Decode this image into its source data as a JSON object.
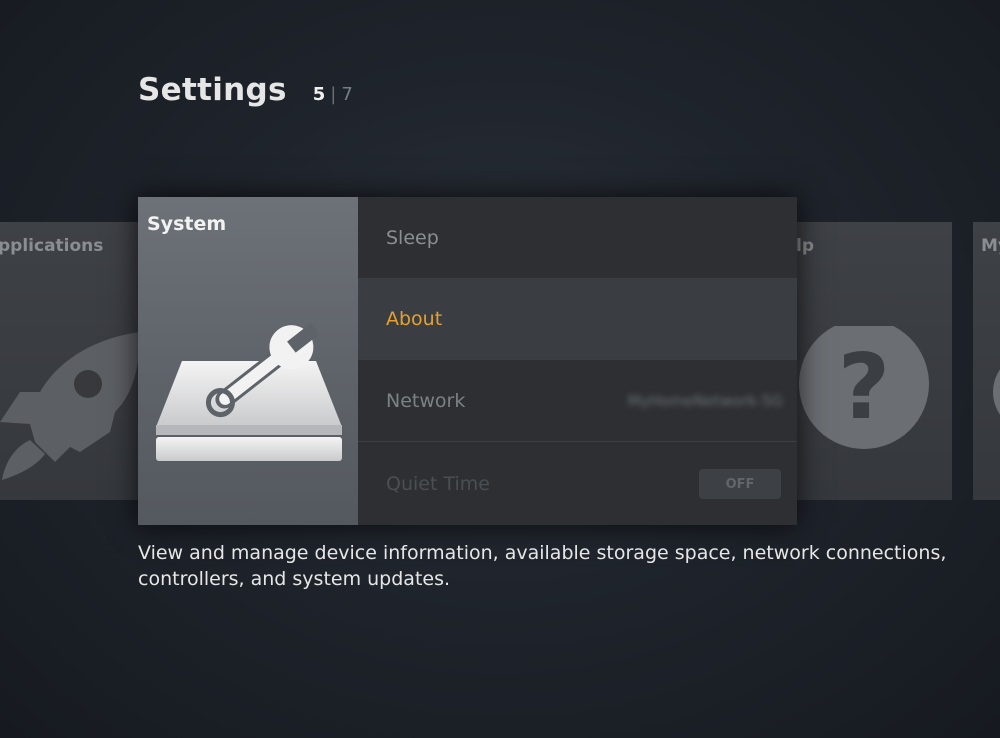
{
  "header": {
    "title": "Settings",
    "pager_current": "5",
    "pager_separator": "|",
    "pager_total": "7"
  },
  "cards": {
    "left_label": "Applications",
    "right_label": "Help",
    "far_right_label": "My"
  },
  "focused": {
    "tile_label": "System",
    "tile_icon": "system-wrench-icon"
  },
  "menu": {
    "items": [
      {
        "label": "Sleep"
      },
      {
        "label": "About"
      },
      {
        "label": "Network",
        "value": "MyHomeNetwork-5G"
      },
      {
        "label": "Quiet Time",
        "toggle": "OFF"
      }
    ]
  },
  "description": "View and manage device information, available storage space, network connections, controllers, and system updates.",
  "colors": {
    "accent": "#e7a02d",
    "background": "#1f242c"
  }
}
